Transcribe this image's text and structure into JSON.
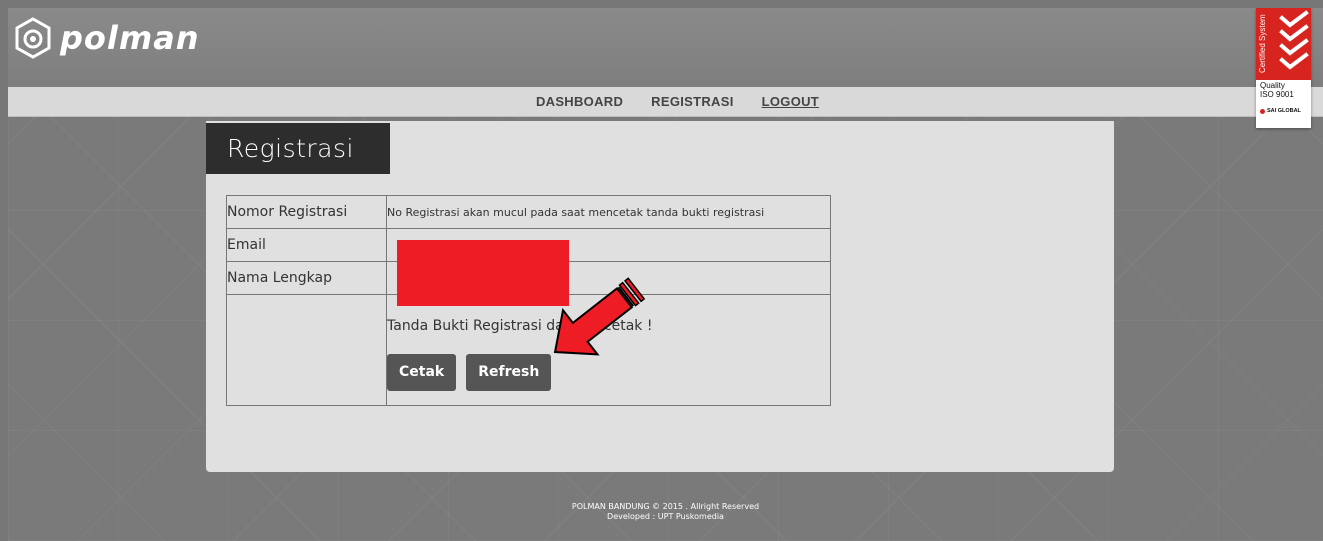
{
  "brand": {
    "logo_text": "polman"
  },
  "nav": {
    "items": [
      {
        "label": "DASHBOARD"
      },
      {
        "label": "REGISTRASI"
      },
      {
        "label": "LOGOUT"
      }
    ]
  },
  "badge": {
    "vertical_text": "Certified System",
    "line1": "Quality",
    "line2": "ISO 9001",
    "issuer": "SAI GLOBAL"
  },
  "page": {
    "title": "Registrasi"
  },
  "form": {
    "rows": [
      {
        "label": "Nomor Registrasi",
        "value": "No Registrasi akan mucul pada saat mencetak tanda bukti registrasi"
      },
      {
        "label": "Email",
        "value": ""
      },
      {
        "label": "Nama Lengkap",
        "value": ""
      }
    ],
    "status_text": "Tanda Bukti Registrasi dapat dicetak !",
    "buttons": {
      "print": "Cetak",
      "refresh": "Refresh"
    }
  },
  "footer": {
    "line1": "POLMAN BANDUNG © 2015 . Allright Reserved",
    "line2": "Developed : UPT Puskomedia"
  },
  "colors": {
    "header_bg": "#858585",
    "navbar_bg": "#d9d9d9",
    "panel_bg": "#e0e0e0",
    "title_bg": "#2d2d2d",
    "button_bg": "#555555",
    "annotation_red": "#ee1c25"
  }
}
